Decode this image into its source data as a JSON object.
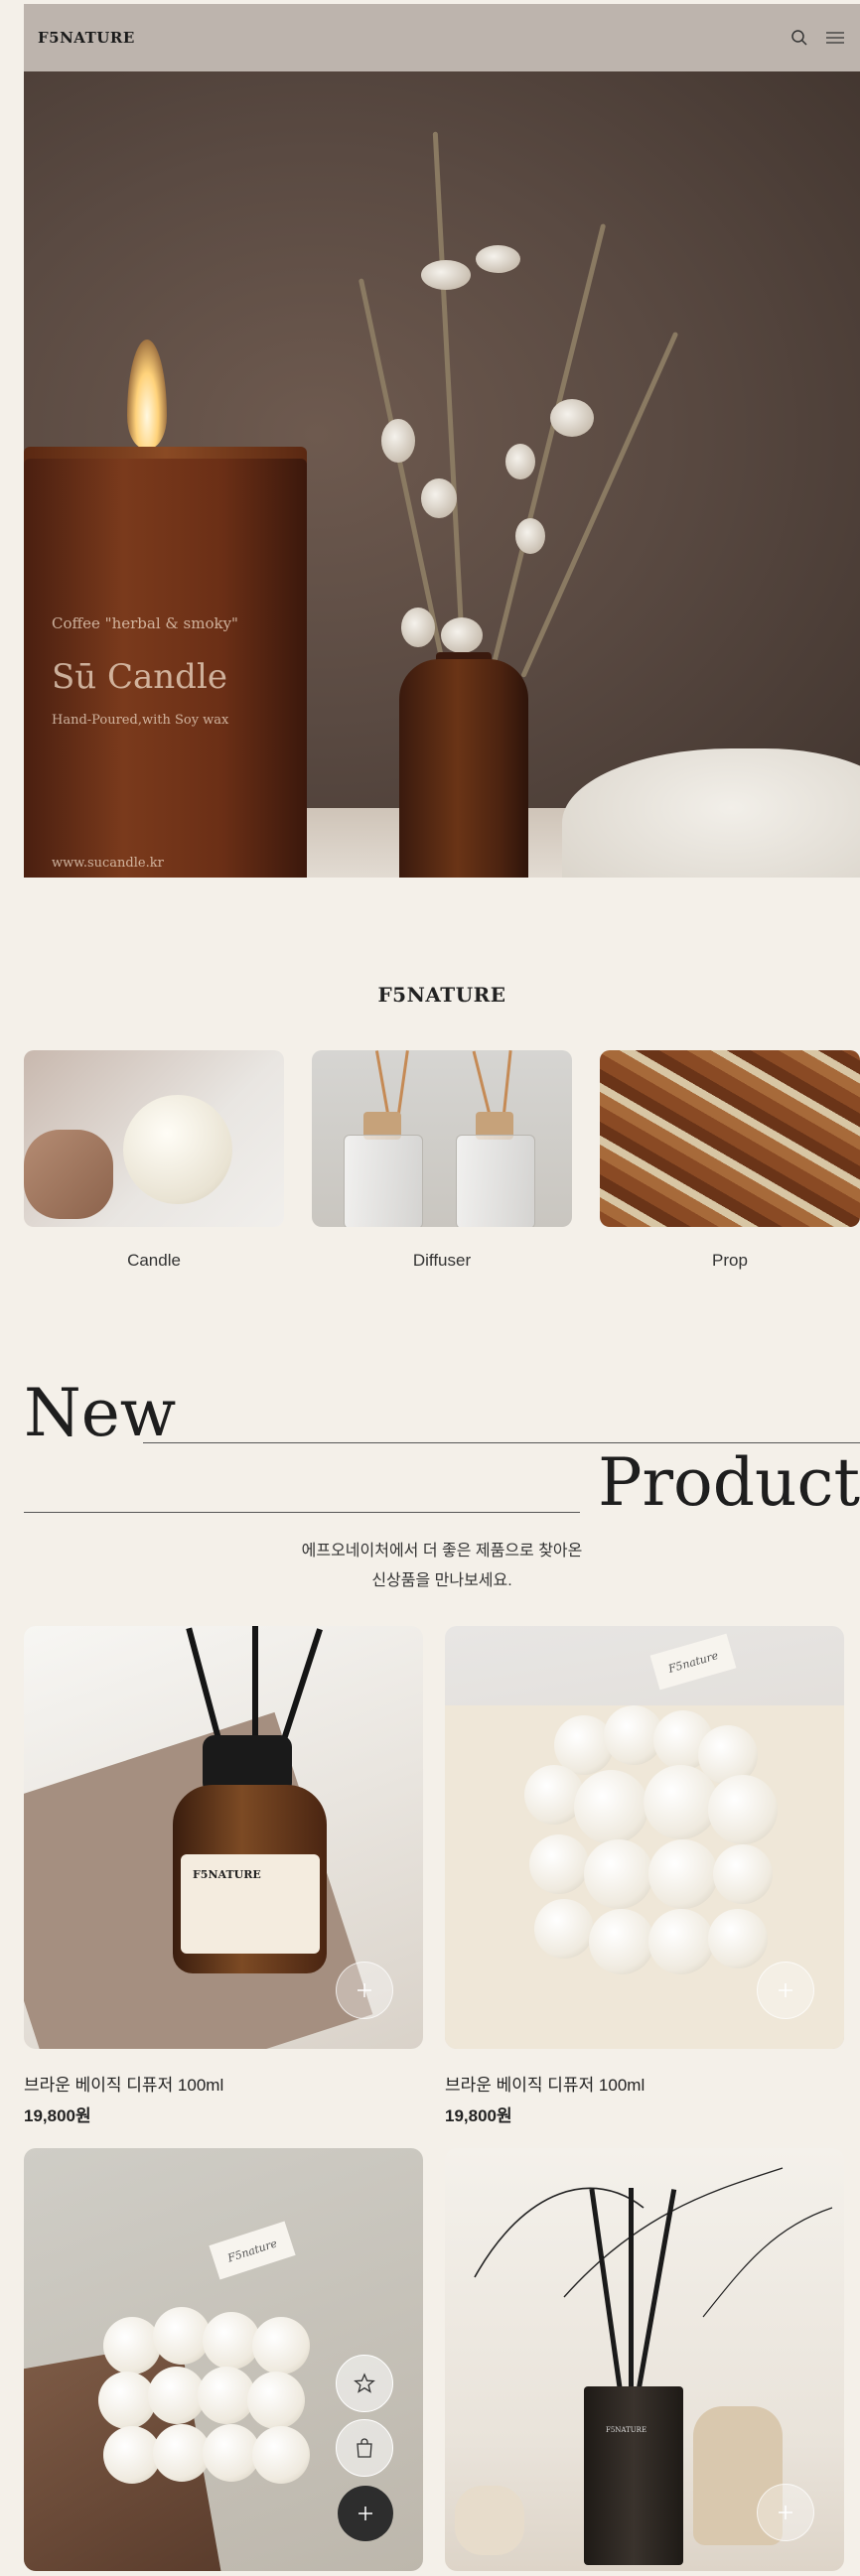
{
  "header": {
    "logo": "F5NATURE",
    "search_icon": "search-icon",
    "menu_icon": "hamburger-menu-icon"
  },
  "hero": {
    "candle_label_line1": "Coffee \"herbal & smoky\"",
    "candle_label_line2": "Sū Candle",
    "candle_label_line3": "Hand-Poured,with Soy wax",
    "candle_label_line4": "www.sucandle.kr"
  },
  "brand": {
    "title": "F5NATURE",
    "categories": [
      {
        "label": "Candle"
      },
      {
        "label": "Diffuser"
      },
      {
        "label": "Prop"
      }
    ]
  },
  "new_product": {
    "heading_new": "New",
    "heading_product": "Product",
    "description_line1": "에프오네이처에서 더 좋은 제품으로 찾아온",
    "description_line2": "신상품을 만나보세요."
  },
  "products": [
    {
      "title": "브라운 베이직 디퓨저 100ml",
      "price": "19,800원",
      "jar_brand": "F5NATURE"
    },
    {
      "title": "브라운 베이직 디퓨저 100ml",
      "price": "19,800원",
      "tag": "F5nature"
    },
    {
      "title": "",
      "price": "",
      "tag": "F5nature"
    },
    {
      "title": "",
      "price": "",
      "bottle_brand": "F5NATURE"
    }
  ],
  "colors": {
    "background": "#f4f0e9",
    "header_bg": "#bdb4ad",
    "dark_button": "#2d2d2d"
  }
}
